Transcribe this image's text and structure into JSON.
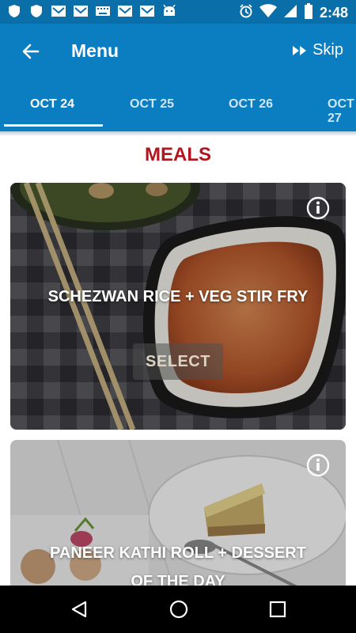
{
  "status_bar": {
    "time": "2:48",
    "left_icons": [
      "shield-icon",
      "shield-icon",
      "gmail-icon",
      "gmail-icon",
      "keyboard-icon",
      "gmail-icon",
      "gmail-icon",
      "android-icon"
    ],
    "right_icons": [
      "alarm-icon",
      "wifi-icon",
      "signal-icon",
      "battery-icon"
    ]
  },
  "app_bar": {
    "title": "Menu",
    "skip_label": "Skip"
  },
  "tabs": [
    {
      "label": "OCT 24",
      "active": true
    },
    {
      "label": "OCT 25",
      "active": false
    },
    {
      "label": "OCT 26",
      "active": false
    },
    {
      "label": "OCT 27",
      "active": false
    }
  ],
  "section": {
    "title": "MEALS"
  },
  "meals": [
    {
      "name": "SCHEZWAN RICE + VEG STIR FRY",
      "select_label": "SELECT"
    },
    {
      "name_line1": "PANEER KATHI ROLL + DESSERT",
      "name_line2": "OF THE DAY"
    }
  ],
  "colors": {
    "status_bar": "#0a6fa8",
    "app_bar": "#0b7ec2",
    "section_title": "#b3141d"
  }
}
